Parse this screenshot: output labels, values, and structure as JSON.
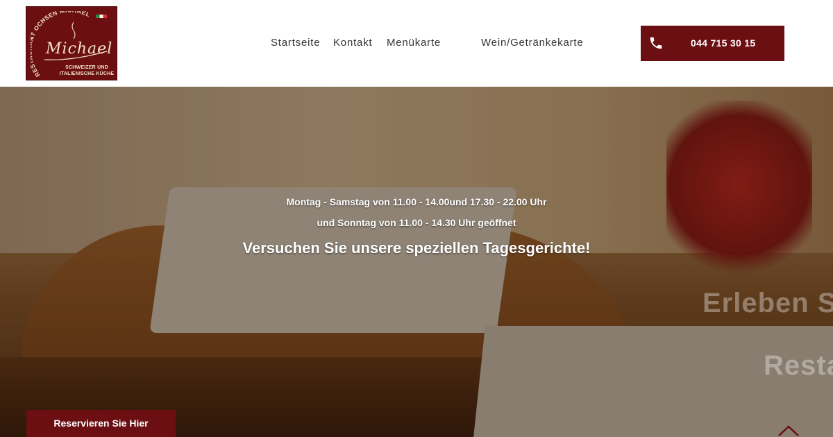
{
  "logo": {
    "arc_text": "RESTAURANT OCHSEN MICHAEL",
    "script_name": "Michael",
    "subtitle_line1": "SCHWEIZER UND",
    "subtitle_line2": "ITALIENISCHE KÜCHE"
  },
  "nav": {
    "items": [
      {
        "label": "Startseite"
      },
      {
        "label": "Kontakt"
      },
      {
        "label": "Menükarte"
      },
      {
        "label": "Wein/Getränkekarte"
      }
    ]
  },
  "phone": {
    "number": "044 715 30 15",
    "icon": "phone-icon"
  },
  "hero": {
    "hours_line1": "Montag - Samstag von 11.00 - 14.00und 17.30 - 22.00 Uhr",
    "hours_line2": "und Sonntag von 11.00 - 14.30 Uhr geöffnet",
    "tagline": "Versuchen Sie unsere speziellen Tagesgerichte!",
    "slide_text_1": "Erleben S",
    "slide_text_2": "Resta"
  },
  "reserve": {
    "label": "Reservieren Sie Hier"
  },
  "colors": {
    "brand": "#6b0f12",
    "text_dark": "#333333",
    "white": "#ffffff"
  }
}
